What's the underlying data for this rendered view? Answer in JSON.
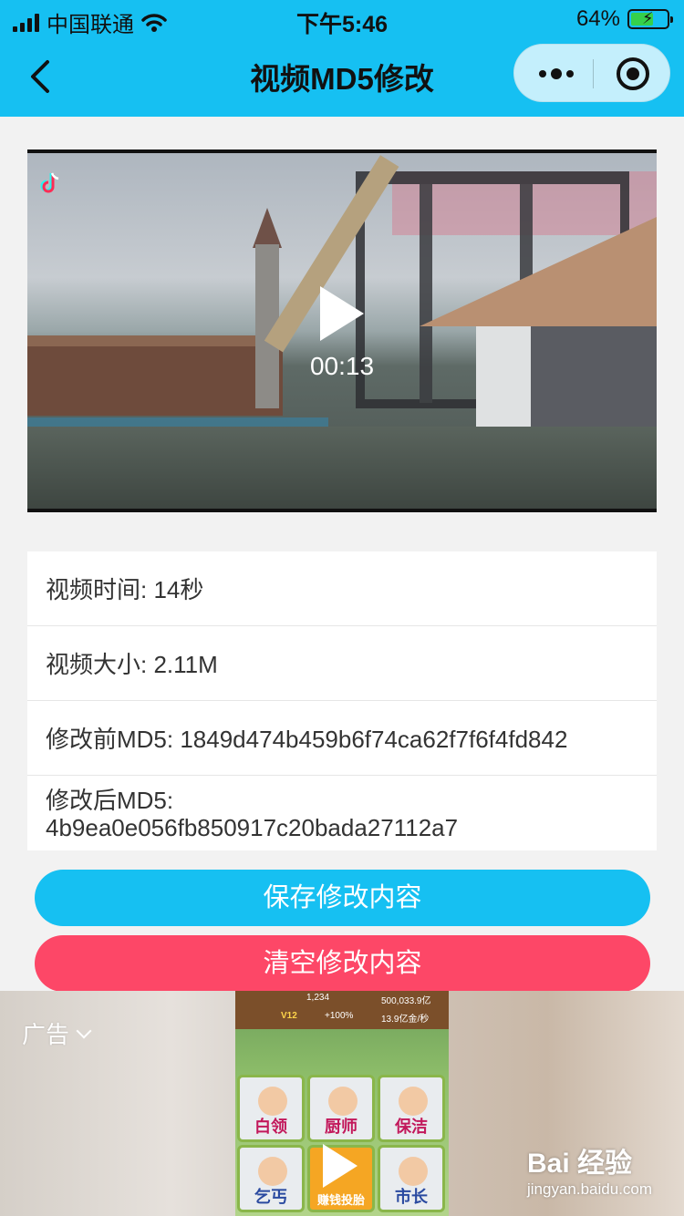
{
  "status_bar": {
    "carrier": "中国联通",
    "time": "下午5:46",
    "battery_percent_label": "64%",
    "battery_level": 0.64
  },
  "nav": {
    "title": "视频MD5修改",
    "back_icon": "chevron-left-icon",
    "more_icon": "more-dots-icon",
    "close_icon": "target-circle-icon"
  },
  "video": {
    "duration": "00:13",
    "logo_icon": "tiktok-logo-icon",
    "play_icon": "play-icon"
  },
  "info": {
    "rows": [
      {
        "label": "视频时间: ",
        "value": "14秒"
      },
      {
        "label": "视频大小: ",
        "value": "2.11M"
      },
      {
        "label": "修改前MD5: ",
        "value": "1849d474b459b6f74ca62f7f6f4fd842"
      },
      {
        "label": "修改后MD5: ",
        "value": "4b9ea0e056fb850917c20bada27112a7"
      }
    ]
  },
  "buttons": {
    "save_label": "保存修改内容",
    "clear_label": "清空修改内容"
  },
  "ad": {
    "label": "广告",
    "game": {
      "stat_1": "1,234",
      "stat_2": "500,033.9亿",
      "level": "V12",
      "bonus": "+100%",
      "rate": "13.9亿金/秒",
      "roles": [
        "白领",
        "厨师",
        "保洁",
        "乞丐",
        "赚钱投胎",
        "市长"
      ]
    },
    "watermark": "Bai 经验",
    "watermark_url": "jingyan.baidu.com"
  },
  "colors": {
    "nav_background": "#16c0f2",
    "save_button": "#16c0f2",
    "clear_button": "#fd4767",
    "page_background": "#f2f2f2"
  }
}
